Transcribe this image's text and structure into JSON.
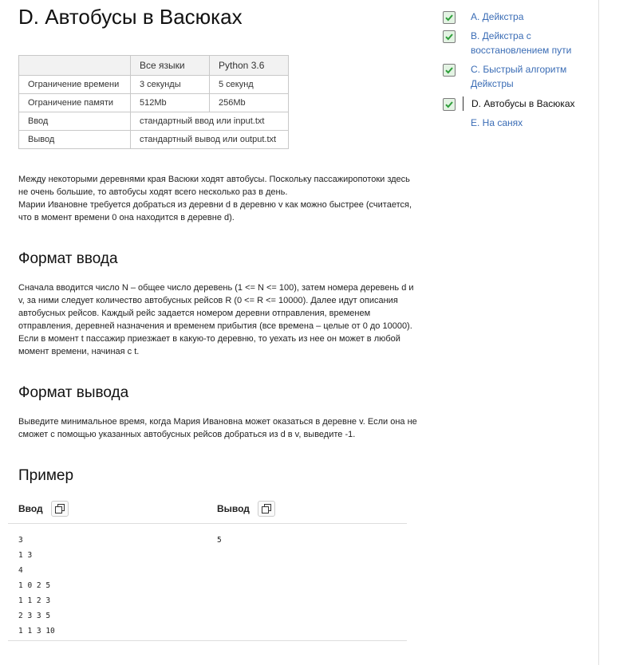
{
  "problem": {
    "title": "D. Автобусы в Васюках",
    "limits": {
      "header": [
        "",
        "Все языки",
        "Python 3.6"
      ],
      "rows": [
        [
          "Ограничение времени",
          "3 секунды",
          "5 секунд"
        ],
        [
          "Ограничение памяти",
          "512Mb",
          "256Mb"
        ],
        [
          "Ввод",
          "стандартный ввод или input.txt"
        ],
        [
          "Вывод",
          "стандартный вывод или output.txt"
        ]
      ]
    },
    "statement": [
      "Между некоторыми деревнями края Васюки ходят автобусы. Поскольку пассажиропотоки здесь не очень большие, то автобусы ходят всего несколько раз в день.",
      "Марии Ивановне требуется добраться из деревни d в деревню v как можно быстрее (считается, что в момент времени 0 она находится в деревне d)."
    ],
    "input_heading": "Формат ввода",
    "input_text": "Сначала вводится число N – общее число деревень (1 <= N <= 100), затем номера деревень d и v, за ними следует количество автобусных рейсов R (0 <= R <= 10000). Далее идут описания автобусных рейсов. Каждый рейс задается номером деревни отправления, временем отправления, деревней назначения и временем прибытия (все времена – целые от 0 до 10000). Если в момент t пассажир приезжает в какую-то деревню, то уехать из нее он может в любой момент времени, начиная с t.",
    "output_heading": "Формат вывода",
    "output_text": "Выведите минимальное время, когда Мария Ивановна может оказаться в деревне v. Если она не сможет с помощью указанных автобусных рейсов добраться из d в v, выведите -1.",
    "example_heading": "Пример",
    "example": {
      "input_label": "Ввод",
      "output_label": "Вывод",
      "input": "3\n1 3\n4\n1 0 2 5\n1 1 2 3\n2 3 3 5\n1 1 3 10",
      "output": "5"
    }
  },
  "nav": {
    "items": [
      {
        "label": "A. Дейкстра",
        "checked": true,
        "active": false
      },
      {
        "label": "B. Дейкстра с восстановлением пути",
        "checked": true,
        "active": false
      },
      {
        "label": "C. Быстрый алгоритм Дейкстры",
        "checked": true,
        "active": false
      },
      {
        "label": "D. Автобусы в Васюках",
        "checked": true,
        "active": true
      },
      {
        "label": "E. На санях",
        "checked": false,
        "active": false
      }
    ]
  },
  "colors": {
    "link": "#3a6cb5",
    "check_fill": "#e3f3e3",
    "check_mark": "#2e9e3a"
  },
  "icons": {
    "check": "checkmark-icon",
    "copy": "copy-icon"
  }
}
